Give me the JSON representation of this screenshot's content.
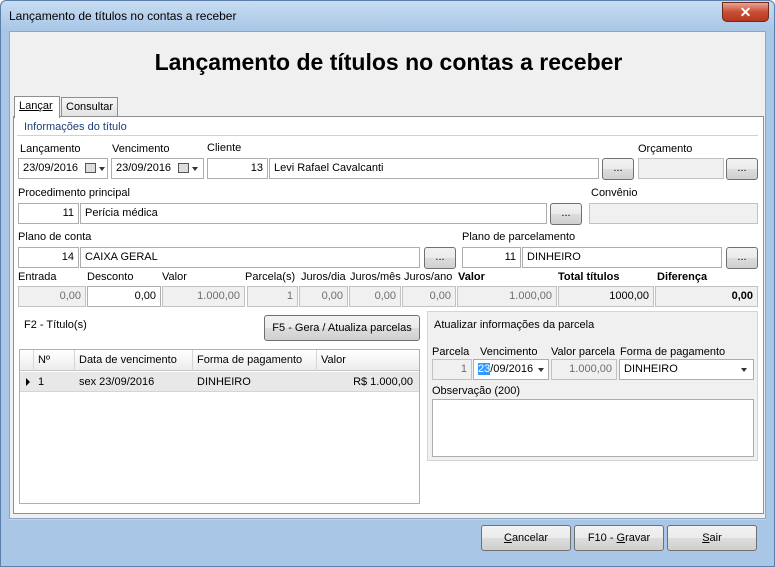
{
  "window": {
    "title": "Lançamento de títulos no contas a receber",
    "close_symbol": "✕"
  },
  "header": {
    "title": "Lançamento de títulos no contas a receber"
  },
  "tabs": [
    {
      "label": "Lançar"
    },
    {
      "label": "Consultar"
    }
  ],
  "info_group": {
    "caption": "Informações do título"
  },
  "fields": {
    "lancamento": {
      "label": "Lançamento",
      "value": "23/09/2016"
    },
    "vencimento": {
      "label": "Vencimento",
      "value": "23/09/2016"
    },
    "cliente": {
      "label": "Cliente",
      "code": "13",
      "name": "Levi Rafael Cavalcanti"
    },
    "orcamento": {
      "label": "Orçamento",
      "value": ""
    },
    "procedimento": {
      "label": "Procedimento principal",
      "code": "11",
      "name": "Perícia médica"
    },
    "convenio": {
      "label": "Convênio",
      "value": ""
    },
    "plano_conta": {
      "label": "Plano de conta",
      "code": "14",
      "name": "CAIXA GERAL"
    },
    "plano_parcelamento": {
      "label": "Plano de parcelamento",
      "code": "11",
      "name": "DINHEIRO"
    },
    "lookup_button": "..."
  },
  "totals": {
    "entrada": {
      "label": "Entrada",
      "value": "0,00"
    },
    "desconto": {
      "label": "Desconto",
      "value": "0,00"
    },
    "valor": {
      "label": "Valor",
      "value": "1.000,00"
    },
    "parcelas": {
      "label": "Parcela(s)",
      "value": "1"
    },
    "juros_dia": {
      "label": "Juros/dia",
      "value": "0,00"
    },
    "juros_mes": {
      "label": "Juros/mês",
      "value": "0,00"
    },
    "juros_ano": {
      "label": "Juros/ano",
      "value": "0,00"
    },
    "valor_total": {
      "label": "Valor",
      "value": "1.000,00"
    },
    "total_titulos": {
      "label": "Total títulos",
      "value": "1000,00"
    },
    "diferenca": {
      "label": "Diferença",
      "value": "0,00"
    }
  },
  "titulos": {
    "caption": "F2 - Título(s)",
    "generate_button": "F5 - Gera / Atualiza parcelas",
    "columns": [
      "Nº",
      "Data de vencimento",
      "Forma de pagamento",
      "Valor"
    ],
    "rows": [
      {
        "numero": "1",
        "vencimento": "sex 23/09/2016",
        "forma": "DINHEIRO",
        "valor": "R$ 1.000,00"
      }
    ]
  },
  "parcela_panel": {
    "caption": "Atualizar informações da parcela",
    "parcela": {
      "label": "Parcela",
      "value": "1"
    },
    "vencimento": {
      "label": "Vencimento",
      "value_selected": "23",
      "value_rest": "/09/2016"
    },
    "valor_parcela": {
      "label": "Valor parcela",
      "value": "1.000,00"
    },
    "forma_pagamento": {
      "label": "Forma de pagamento",
      "value": "DINHEIRO"
    },
    "observacao": {
      "label": "Observação (200)",
      "value": ""
    }
  },
  "footer": {
    "cancel": {
      "pre": "",
      "u": "C",
      "post": "ancelar"
    },
    "save": {
      "pre": "F10 - ",
      "u": "G",
      "post": "ravar"
    },
    "exit": {
      "pre": "",
      "u": "S",
      "post": "air"
    }
  }
}
